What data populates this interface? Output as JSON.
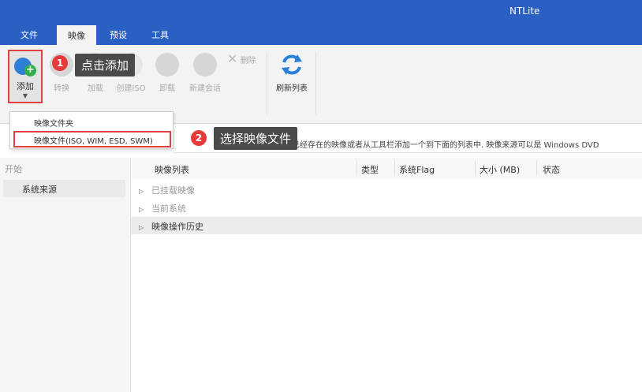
{
  "app": {
    "title": "NTLite"
  },
  "tabs": [
    {
      "label": "文件",
      "active": false
    },
    {
      "label": "映像",
      "active": true
    },
    {
      "label": "预设",
      "active": false
    },
    {
      "label": "工具",
      "active": false
    }
  ],
  "ribbon": {
    "add": "添加",
    "convert": "转换",
    "mount": "加载",
    "create_iso": "创建ISO",
    "unmount": "卸载",
    "new_session": "新建会话",
    "delete": "删除",
    "refresh": "刷新列表"
  },
  "annotations": {
    "step1": {
      "number": "1",
      "text": "点击添加"
    },
    "step2": {
      "number": "2",
      "text": "选择映像文件"
    }
  },
  "dropdown": {
    "items": [
      "映像文件夹",
      "映像文件(ISO, WIM, ESD, SWM)"
    ]
  },
  "infobar": {
    "text": "已经存在的映像或者从工具栏添加一个到下面的列表中. 映像来源可以是 Windows DVD"
  },
  "sidebar": {
    "header": "开始",
    "items": [
      "系统来源"
    ]
  },
  "table": {
    "columns": [
      "映像列表",
      "类型",
      "系统Flag",
      "大小 (MB)",
      "状态"
    ],
    "rows": [
      {
        "label": "已挂载映像",
        "active": false
      },
      {
        "label": "当前系统",
        "active": false
      },
      {
        "label": "映像操作历史",
        "active": true
      }
    ]
  },
  "colors": {
    "accent": "#2a5fc4",
    "highlight": "#e04040",
    "badge": "#e53b3b"
  }
}
